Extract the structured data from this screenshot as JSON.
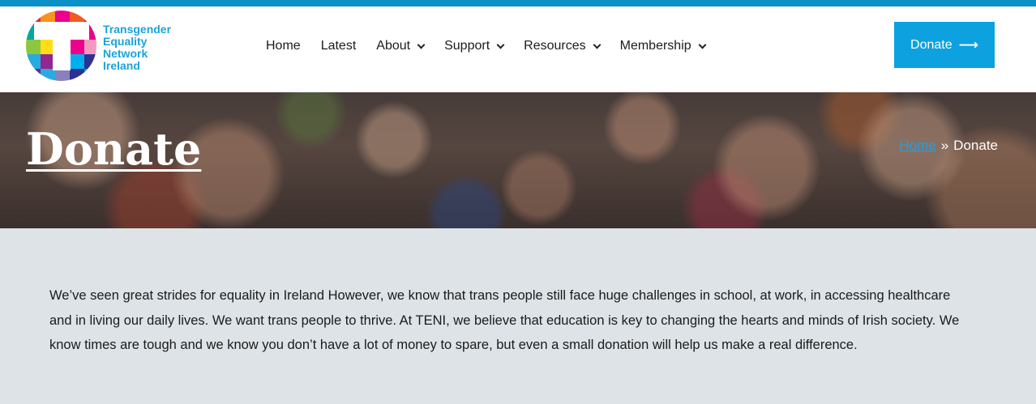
{
  "header": {
    "logo": {
      "line1": "Transgender",
      "line2": "Equality",
      "line3": "Network",
      "line4": "Ireland"
    },
    "nav": [
      {
        "label": "Home",
        "dropdown": false
      },
      {
        "label": "Latest",
        "dropdown": false
      },
      {
        "label": "About",
        "dropdown": true
      },
      {
        "label": "Support",
        "dropdown": true
      },
      {
        "label": "Resources",
        "dropdown": true
      },
      {
        "label": "Membership",
        "dropdown": true
      }
    ],
    "donate_label": "Donate",
    "donate_icon": "arrow-right-icon",
    "chevron_icon": "chevron-down-icon"
  },
  "hero": {
    "title": "Donate",
    "breadcrumb": {
      "home": "Home",
      "separator": "»",
      "current": "Donate"
    }
  },
  "content": {
    "paragraph": "We’ve seen great strides for equality in Ireland However, we know that trans people still face huge challenges in school, at work, in accessing healthcare and in living our daily lives. We want trans people to thrive. At TENI, we believe that education is key to changing the hearts and minds of Irish society. We know times are tough and we know you don’t have a lot of money to spare, but even a small donation will help us make a real difference."
  },
  "colors": {
    "accent": "#0ea1df",
    "top_bar": "#0a8fc6",
    "body_background": "#dde3e7",
    "breadcrumb_link": "#1aa3e6"
  }
}
